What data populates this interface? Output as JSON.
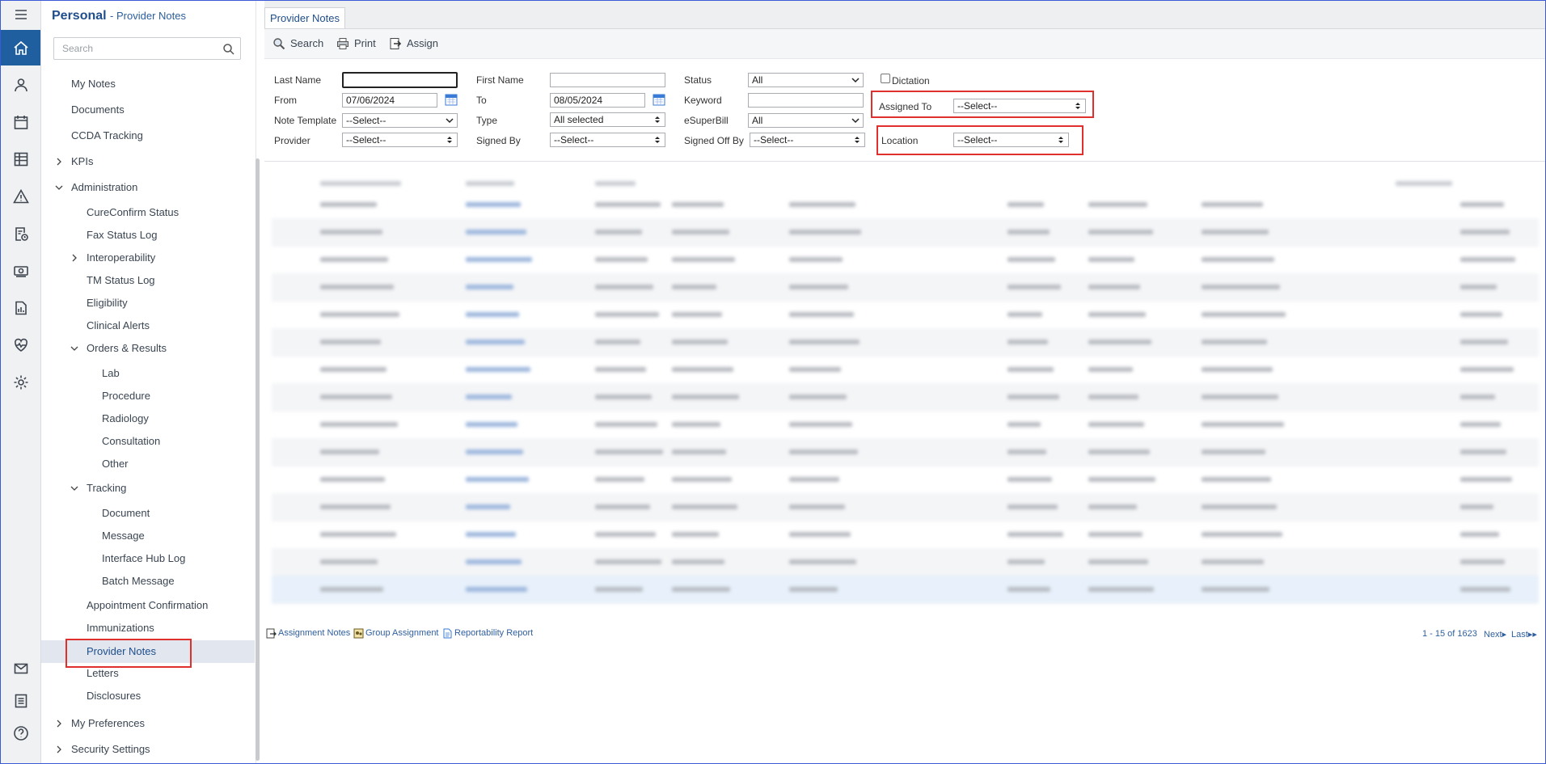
{
  "sidebar": {
    "title": "Personal",
    "subtitle": "- Provider Notes",
    "search_placeholder": "Search",
    "items": [
      {
        "label": "My Notes"
      },
      {
        "label": "Documents"
      },
      {
        "label": "CCDA Tracking"
      },
      {
        "label": "KPIs"
      },
      {
        "label": "Administration"
      },
      {
        "label": "CureConfirm Status"
      },
      {
        "label": "Fax Status Log"
      },
      {
        "label": "Interoperability"
      },
      {
        "label": "TM Status Log"
      },
      {
        "label": "Eligibility"
      },
      {
        "label": "Clinical Alerts"
      },
      {
        "label": "Orders & Results"
      },
      {
        "label": "Lab"
      },
      {
        "label": "Procedure"
      },
      {
        "label": "Radiology"
      },
      {
        "label": "Consultation"
      },
      {
        "label": "Other"
      },
      {
        "label": "Tracking"
      },
      {
        "label": "Document"
      },
      {
        "label": "Message"
      },
      {
        "label": "Interface Hub Log"
      },
      {
        "label": "Batch Message"
      },
      {
        "label": "Appointment Confirmation"
      },
      {
        "label": "Immunizations"
      },
      {
        "label": "Provider Notes"
      },
      {
        "label": "Letters"
      },
      {
        "label": "Disclosures"
      },
      {
        "label": "My Preferences"
      },
      {
        "label": "Security Settings"
      }
    ]
  },
  "main": {
    "tab": "Provider Notes",
    "toolbar": {
      "search": "Search",
      "print": "Print",
      "assign": "Assign"
    },
    "filters": {
      "last_name": "Last Name",
      "first_name": "First Name",
      "status": "Status",
      "status_value": "All",
      "dictation": "Dictation",
      "from": "From",
      "from_value": "07/06/2024",
      "to": "To",
      "to_value": "08/05/2024",
      "keyword": "Keyword",
      "assigned_to": "Assigned To",
      "assigned_to_value": "--Select--",
      "note_template": "Note Template",
      "note_template_value": "--Select--",
      "type": "Type",
      "type_value": "All selected",
      "esuperbill": "eSuperBill",
      "esuperbill_value": "All",
      "provider": "Provider",
      "provider_value": "--Select--",
      "signed_by": "Signed By",
      "signed_by_value": "--Select--",
      "signed_off_by": "Signed Off By",
      "signed_off_by_value": "--Select--",
      "location": "Location",
      "location_value": "--Select--"
    },
    "footer": {
      "assignment_notes": "Assignment Notes",
      "group_assignment": "Group Assignment",
      "reportability_report": "Reportability Report",
      "pager_range": "1 - 15 of 1623",
      "next": "Next",
      "last": "Last"
    }
  },
  "colors": {
    "brand": "#1f5fa0",
    "highlight_box": "#e0302d",
    "link": "#2f5f9e"
  }
}
